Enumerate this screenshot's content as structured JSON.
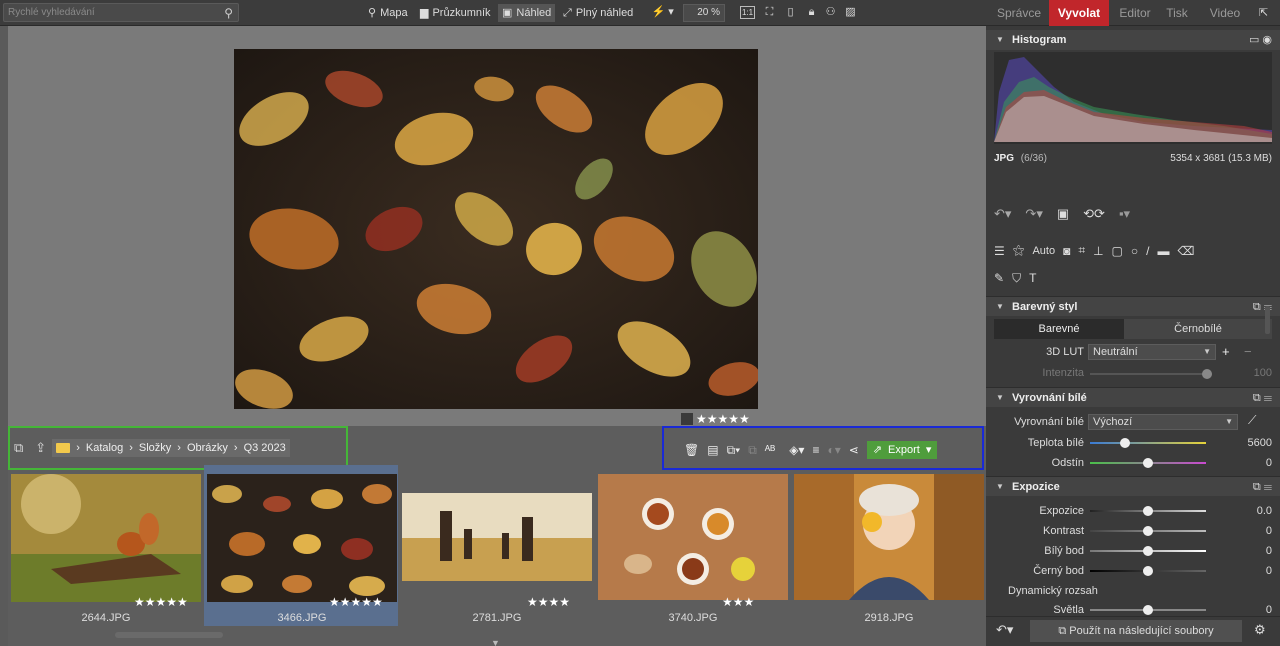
{
  "search": {
    "placeholder": "Rychlé vyhledávání",
    "icon": "magnifier-icon"
  },
  "nav": [
    {
      "label": "Mapa",
      "icon": "map-pin-icon"
    },
    {
      "label": "Průzkumník",
      "icon": "folder-icon"
    },
    {
      "label": "Náhled",
      "icon": "image-icon",
      "active": true
    },
    {
      "label": "Plný náhled",
      "icon": "fullscreen-icon"
    }
  ],
  "toolbar": {
    "zoom": "20 %",
    "one_to_one": "1:1"
  },
  "modes": [
    {
      "label": "Správce",
      "active": false
    },
    {
      "label": "Vyvolat",
      "active": true
    },
    {
      "label": "Editor",
      "active": false
    },
    {
      "label": "Tisk",
      "active": false
    },
    {
      "label": "Video",
      "active": false
    }
  ],
  "viewer": {
    "stars": "★★★★★",
    "rating": 5
  },
  "breadcrumb": {
    "items": [
      "Katalog",
      "Složky",
      "Obrázky",
      "Q3 2023"
    ]
  },
  "actions": {
    "export_label": "Export"
  },
  "thumbnails": [
    {
      "name": "2644.JPG",
      "stars": "★★★★★",
      "rating": 5,
      "subject": "squirrel"
    },
    {
      "name": "3466.JPG",
      "stars": "★★★★★",
      "rating": 5,
      "subject": "leaves",
      "selected": true
    },
    {
      "name": "2781.JPG",
      "stars": "★★★★",
      "rating": 4,
      "subject": "family"
    },
    {
      "name": "3740.JPG",
      "stars": "★★★",
      "rating": 3,
      "subject": "tea"
    },
    {
      "name": "2918.JPG",
      "stars": "",
      "rating": 0,
      "subject": "girl"
    }
  ],
  "panel": {
    "histogram_title": "Histogram",
    "file_type": "JPG",
    "file_index": "(6/36)",
    "file_info": "5354 x 3681 (15.3 MB)",
    "auto_label": "Auto",
    "color_style": {
      "title": "Barevný styl",
      "tab_color": "Barevné",
      "tab_bw": "Černobílé",
      "lut_label": "3D LUT",
      "lut_value": "Neutrální",
      "intensity_label": "Intenzita",
      "intensity_value": "100"
    },
    "white_balance": {
      "title": "Vyrovnání bílé",
      "wb_label": "Vyrovnání bílé",
      "wb_value": "Výchozí",
      "temp_label": "Teplota bílé",
      "temp_value": "5600",
      "tint_label": "Odstín",
      "tint_value": "0"
    },
    "exposure": {
      "title": "Expozice",
      "rows": [
        {
          "label": "Expozice",
          "value": "0.0"
        },
        {
          "label": "Kontrast",
          "value": "0"
        },
        {
          "label": "Bílý bod",
          "value": "0"
        },
        {
          "label": "Černý bod",
          "value": "0"
        }
      ],
      "dynamic_label": "Dynamický rozsah",
      "highlights_label": "Světla",
      "highlights_value": "0"
    },
    "apply_label": "Použít na následující soubory"
  }
}
